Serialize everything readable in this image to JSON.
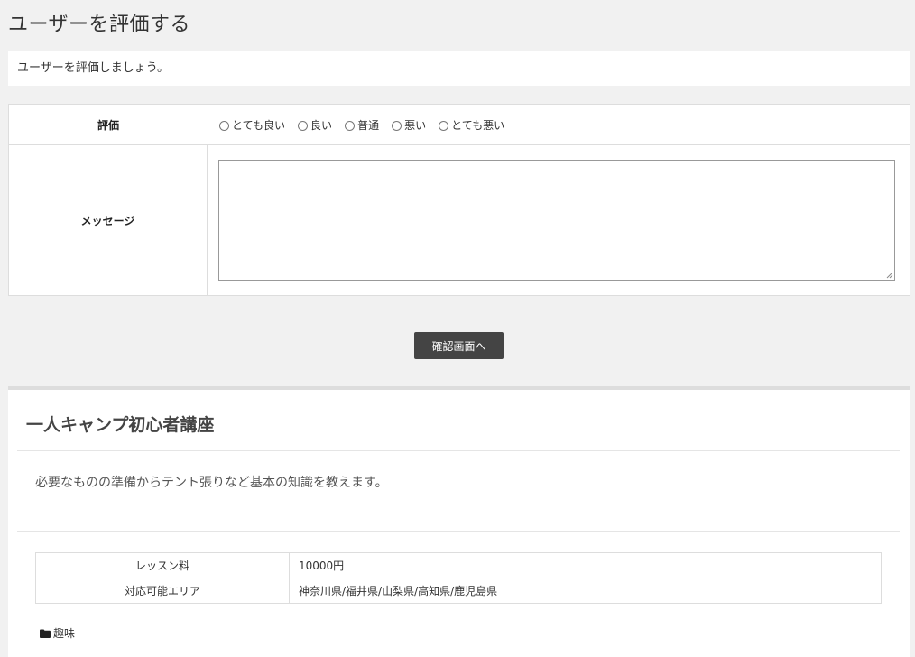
{
  "page": {
    "title": "ユーザーを評価する",
    "intro": "ユーザーを評価しましょう。"
  },
  "form": {
    "rating_label": "評価",
    "rating_options": [
      "とても良い",
      "良い",
      "普通",
      "悪い",
      "とても悪い"
    ],
    "message_label": "メッセージ",
    "message_value": ""
  },
  "confirm_button": "確認画面へ",
  "lesson": {
    "title": "一人キャンプ初心者講座",
    "description": "必要なものの準備からテント張りなど基本の知識を教えます。",
    "details": [
      {
        "key": "レッスン料",
        "value": "10000円"
      },
      {
        "key": "対応可能エリア",
        "value": "神奈川県/福井県/山梨県/高知県/鹿児島県"
      }
    ],
    "category_icon": "folder-icon",
    "category": "趣味"
  }
}
